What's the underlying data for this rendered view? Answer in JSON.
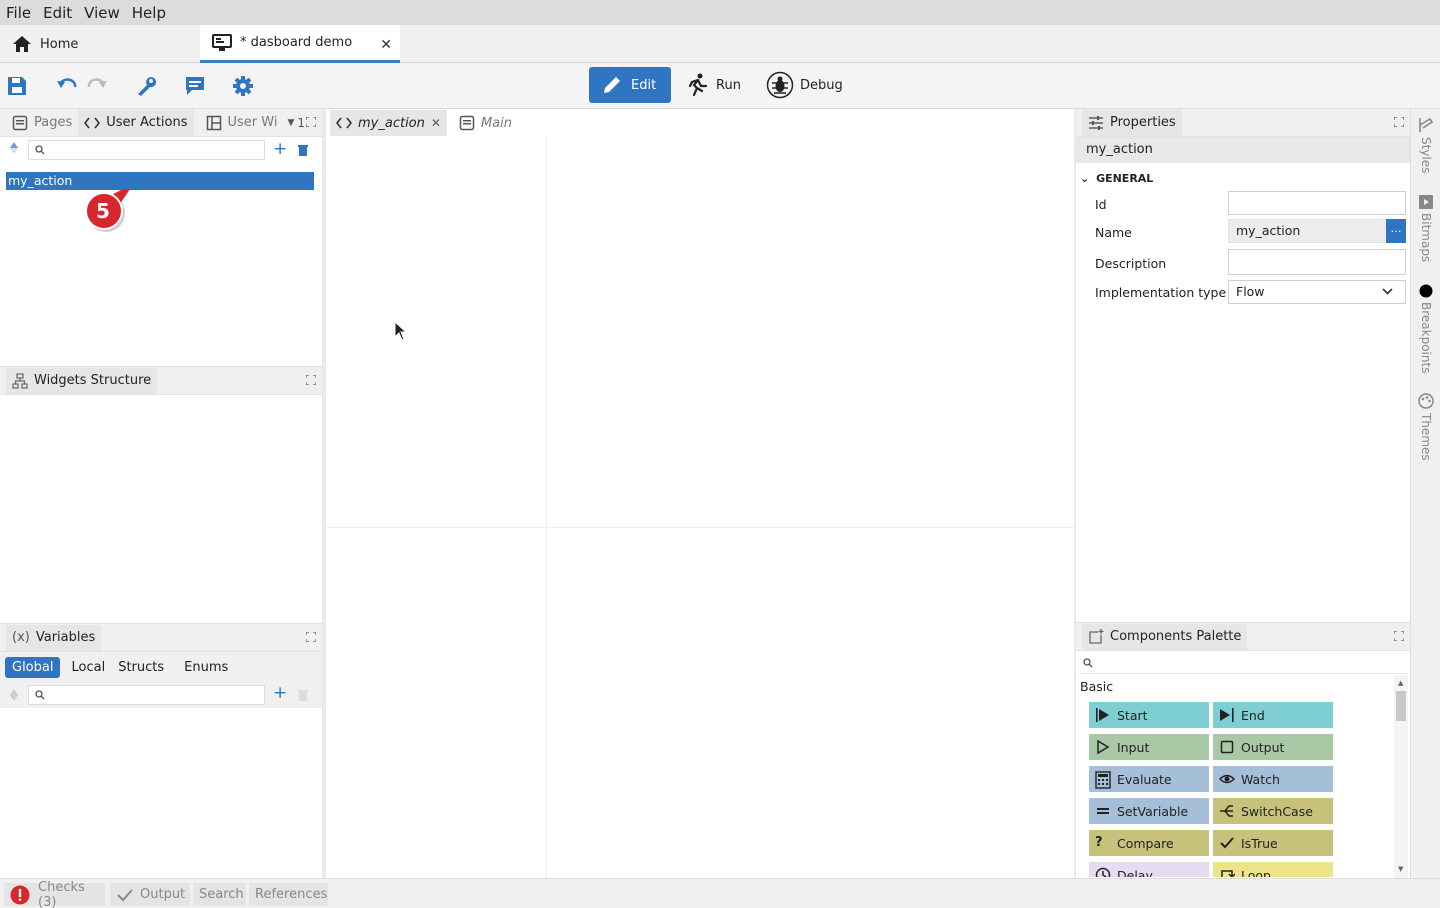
{
  "menu": {
    "items": [
      "File",
      "Edit",
      "View",
      "Help"
    ]
  },
  "tabs": {
    "home": "Home",
    "doc": "* dasboard demo"
  },
  "toolbar": {
    "edit": "Edit",
    "run": "Run",
    "debug": "Debug"
  },
  "left_panel": {
    "tabs": [
      "Pages",
      "User Actions",
      "User Wi"
    ],
    "tab_count": "1",
    "items": [
      "my_action"
    ],
    "badge": "5"
  },
  "widgets_structure": {
    "title": "Widgets Structure"
  },
  "variables": {
    "title": "Variables",
    "icon_text": "(x)",
    "tabs": [
      "Global",
      "Local",
      "Structs",
      "Enums"
    ]
  },
  "editor": {
    "tabs": [
      "my_action",
      "Main"
    ]
  },
  "properties": {
    "title": "Properties",
    "selected": "my_action",
    "section": "GENERAL",
    "fields": [
      {
        "label": "Id",
        "value": ""
      },
      {
        "label": "Name",
        "value": "my_action"
      },
      {
        "label": "Description",
        "value": ""
      },
      {
        "label": "Implementation type",
        "value": "Flow"
      }
    ]
  },
  "palette": {
    "title": "Components Palette",
    "group": "Basic",
    "items": [
      {
        "label": "Start",
        "color": "#7ecfd3"
      },
      {
        "label": "End",
        "color": "#7ecfd3"
      },
      {
        "label": "Input",
        "color": "#a9c9a6"
      },
      {
        "label": "Output",
        "color": "#a9c9a6"
      },
      {
        "label": "Evaluate",
        "color": "#a4bfd7"
      },
      {
        "label": "Watch",
        "color": "#a4bfd7"
      },
      {
        "label": "SetVariable",
        "color": "#a4bfd7"
      },
      {
        "label": "SwitchCase",
        "color": "#c6c27b"
      },
      {
        "label": "Compare",
        "color": "#c6c27b"
      },
      {
        "label": "IsTrue",
        "color": "#c6c27b"
      },
      {
        "label": "Delay",
        "color": "#e4dcf0"
      },
      {
        "label": "Loop",
        "color": "#ede489"
      }
    ]
  },
  "side_strip": [
    "Styles",
    "Bitmaps",
    "Breakpoints",
    "Themes"
  ],
  "status": {
    "checks": "Checks (3)",
    "output": "Output",
    "search": "Search",
    "references": "References"
  },
  "colors": {
    "accent": "#2f75c2",
    "badge": "#d9262b"
  }
}
